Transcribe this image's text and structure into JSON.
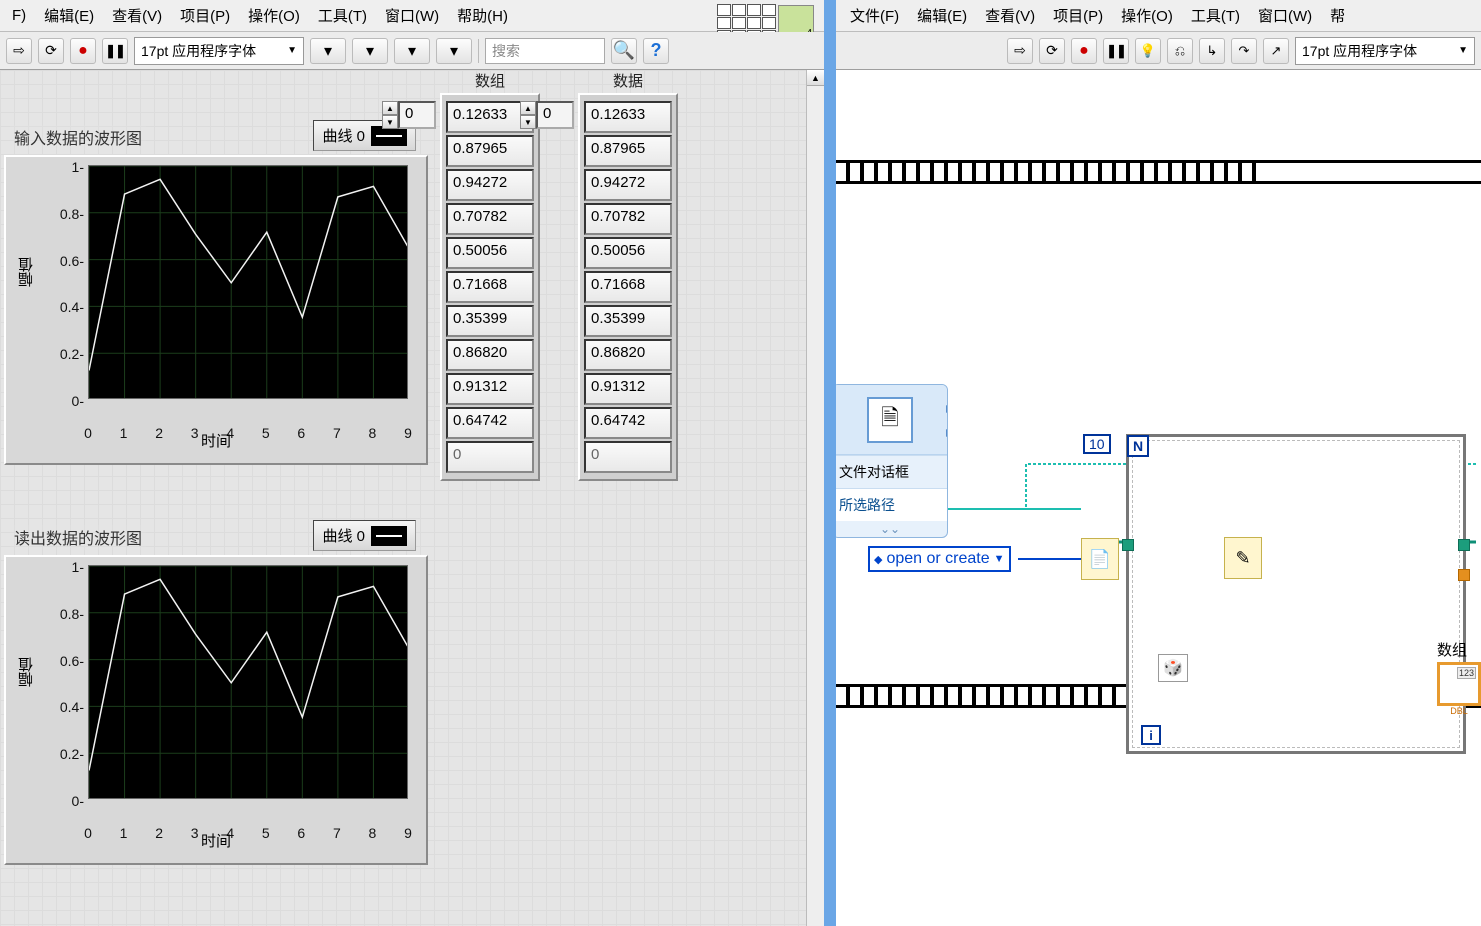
{
  "menus": {
    "left": [
      "F)",
      "编辑(E)",
      "查看(V)",
      "项目(P)",
      "操作(O)",
      "工具(T)",
      "窗口(W)",
      "帮助(H)"
    ],
    "right": [
      "文件(F)",
      "编辑(E)",
      "查看(V)",
      "项目(P)",
      "操作(O)",
      "工具(T)",
      "窗口(W)",
      "帮"
    ]
  },
  "toolbar": {
    "font_label": "17pt 应用程序字体",
    "search_placeholder": "搜索",
    "palette_badge": "4"
  },
  "arrays": {
    "col1_label": "数组",
    "col2_label": "数据",
    "index_value": "0",
    "values": [
      "0.12633",
      "0.87965",
      "0.94272",
      "0.70782",
      "0.50056",
      "0.71668",
      "0.35399",
      "0.86820",
      "0.91312",
      "0.64742"
    ],
    "trailing_empty": "0"
  },
  "chart1": {
    "title": "输入数据的波形图",
    "legend": "曲线 0",
    "xlabel": "时间",
    "ylabel": "幅值"
  },
  "chart2": {
    "title": "读出数据的波形图",
    "legend": "曲线 0",
    "xlabel": "时间",
    "ylabel": "幅值"
  },
  "chart_data": {
    "type": "line",
    "x": [
      0,
      1,
      2,
      3,
      4,
      5,
      6,
      7,
      8,
      9
    ],
    "y": [
      0.126,
      0.88,
      0.943,
      0.708,
      0.501,
      0.717,
      0.354,
      0.868,
      0.913,
      0.647
    ],
    "yticks": [
      0,
      0.2,
      0.4,
      0.6,
      0.8,
      1
    ],
    "xticks": [
      0,
      1,
      2,
      3,
      4,
      5,
      6,
      7,
      8,
      9
    ],
    "ylim": [
      0,
      1
    ],
    "xlim": [
      0,
      9
    ]
  },
  "block_diagram": {
    "express_vi_title": "文件对话框",
    "express_vi_selected": "所选路径",
    "enum_label": "open or create",
    "loop_count": "10",
    "indicator_label": "数组",
    "indicator_type": "DBL"
  }
}
